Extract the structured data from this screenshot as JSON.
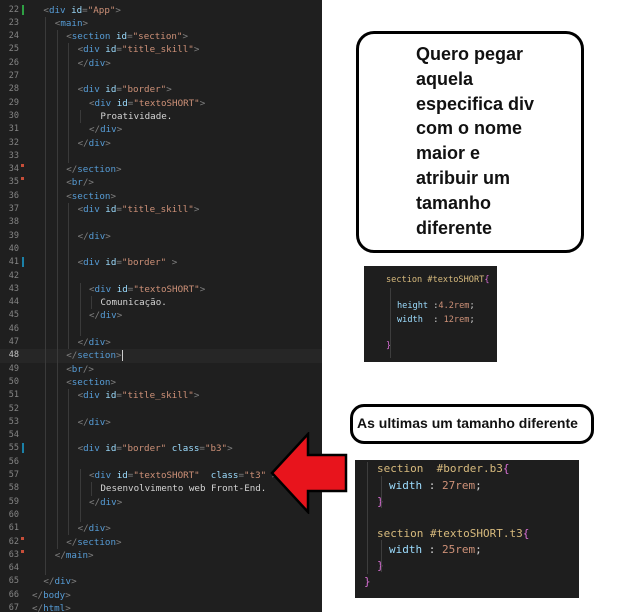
{
  "editor": {
    "lines": [
      {
        "n": "22",
        "indent": 1,
        "parts": [
          [
            "t",
            "<"
          ],
          [
            "tn",
            "div"
          ],
          [
            "sp",
            " "
          ],
          [
            "an",
            "id"
          ],
          [
            "t",
            "="
          ],
          [
            "av",
            "\"App\""
          ],
          [
            "t",
            ">"
          ]
        ]
      },
      {
        "n": "23",
        "indent": 2,
        "parts": [
          [
            "t",
            "<"
          ],
          [
            "tn",
            "main"
          ],
          [
            "t",
            ">"
          ]
        ]
      },
      {
        "n": "24",
        "indent": 3,
        "parts": [
          [
            "t",
            "<"
          ],
          [
            "tn",
            "section"
          ],
          [
            "sp",
            " "
          ],
          [
            "an",
            "id"
          ],
          [
            "t",
            "="
          ],
          [
            "av",
            "\"section\""
          ],
          [
            "t",
            ">"
          ]
        ]
      },
      {
        "n": "25",
        "indent": 4,
        "parts": [
          [
            "t",
            "<"
          ],
          [
            "tn",
            "div"
          ],
          [
            "sp",
            " "
          ],
          [
            "an",
            "id"
          ],
          [
            "t",
            "="
          ],
          [
            "av",
            "\"title_skill\""
          ],
          [
            "t",
            ">"
          ]
        ]
      },
      {
        "n": "26",
        "indent": 4,
        "parts": [
          [
            "t",
            "</"
          ],
          [
            "tn",
            "div"
          ],
          [
            "t",
            ">"
          ]
        ]
      },
      {
        "n": "27",
        "indent": 0,
        "parts": []
      },
      {
        "n": "28",
        "indent": 4,
        "parts": [
          [
            "t",
            "<"
          ],
          [
            "tn",
            "div"
          ],
          [
            "sp",
            " "
          ],
          [
            "an",
            "id"
          ],
          [
            "t",
            "="
          ],
          [
            "av",
            "\"border\""
          ],
          [
            "t",
            ">"
          ]
        ]
      },
      {
        "n": "29",
        "indent": 5,
        "parts": [
          [
            "t",
            "<"
          ],
          [
            "tn",
            "div"
          ],
          [
            "sp",
            " "
          ],
          [
            "an",
            "id"
          ],
          [
            "t",
            "="
          ],
          [
            "av",
            "\"textoSHORT\""
          ],
          [
            "t",
            ">"
          ]
        ]
      },
      {
        "n": "30",
        "indent": 6,
        "parts": [
          [
            "tx",
            "Proatividade."
          ]
        ]
      },
      {
        "n": "31",
        "indent": 5,
        "parts": [
          [
            "t",
            "</"
          ],
          [
            "tn",
            "div"
          ],
          [
            "t",
            ">"
          ]
        ]
      },
      {
        "n": "32",
        "indent": 4,
        "parts": [
          [
            "t",
            "</"
          ],
          [
            "tn",
            "div"
          ],
          [
            "t",
            ">"
          ]
        ]
      },
      {
        "n": "33",
        "indent": 0,
        "parts": []
      },
      {
        "n": "34",
        "indent": 3,
        "parts": [
          [
            "t",
            "</"
          ],
          [
            "tn",
            "section"
          ],
          [
            "t",
            ">"
          ]
        ]
      },
      {
        "n": "35",
        "indent": 3,
        "parts": [
          [
            "t",
            "<"
          ],
          [
            "tn",
            "br"
          ],
          [
            "t",
            "/>"
          ]
        ]
      },
      {
        "n": "36",
        "indent": 3,
        "parts": [
          [
            "t",
            "<"
          ],
          [
            "tn",
            "section"
          ],
          [
            "t",
            ">"
          ]
        ]
      },
      {
        "n": "37",
        "indent": 4,
        "parts": [
          [
            "t",
            "<"
          ],
          [
            "tn",
            "div"
          ],
          [
            "sp",
            " "
          ],
          [
            "an",
            "id"
          ],
          [
            "t",
            "="
          ],
          [
            "av",
            "\"title_skill\""
          ],
          [
            "t",
            ">"
          ]
        ]
      },
      {
        "n": "38",
        "indent": 0,
        "parts": []
      },
      {
        "n": "39",
        "indent": 4,
        "parts": [
          [
            "t",
            "</"
          ],
          [
            "tn",
            "div"
          ],
          [
            "t",
            ">"
          ]
        ]
      },
      {
        "n": "40",
        "indent": 0,
        "parts": []
      },
      {
        "n": "41",
        "indent": 4,
        "parts": [
          [
            "t",
            "<"
          ],
          [
            "tn",
            "div"
          ],
          [
            "sp",
            " "
          ],
          [
            "an",
            "id"
          ],
          [
            "t",
            "="
          ],
          [
            "av",
            "\"border\""
          ],
          [
            "sp",
            " "
          ],
          [
            "t",
            ">"
          ]
        ]
      },
      {
        "n": "42",
        "indent": 0,
        "parts": []
      },
      {
        "n": "43",
        "indent": 5,
        "parts": [
          [
            "t",
            "<"
          ],
          [
            "tn",
            "div"
          ],
          [
            "sp",
            " "
          ],
          [
            "an",
            "id"
          ],
          [
            "t",
            "="
          ],
          [
            "av",
            "\"textoSHORT\""
          ],
          [
            "t",
            ">"
          ]
        ]
      },
      {
        "n": "44",
        "indent": 6,
        "parts": [
          [
            "tx",
            "Comunicação."
          ]
        ]
      },
      {
        "n": "45",
        "indent": 5,
        "parts": [
          [
            "t",
            "</"
          ],
          [
            "tn",
            "div"
          ],
          [
            "t",
            ">"
          ]
        ]
      },
      {
        "n": "46",
        "indent": 0,
        "parts": []
      },
      {
        "n": "47",
        "indent": 4,
        "parts": [
          [
            "t",
            "</"
          ],
          [
            "tn",
            "div"
          ],
          [
            "t",
            ">"
          ]
        ]
      },
      {
        "n": "48",
        "indent": 3,
        "parts": [
          [
            "t",
            "</"
          ],
          [
            "tn",
            "section"
          ],
          [
            "t",
            ">"
          ]
        ]
      },
      {
        "n": "49",
        "indent": 3,
        "parts": [
          [
            "t",
            "<"
          ],
          [
            "tn",
            "br"
          ],
          [
            "t",
            "/>"
          ]
        ]
      },
      {
        "n": "50",
        "indent": 3,
        "parts": [
          [
            "t",
            "<"
          ],
          [
            "tn",
            "section"
          ],
          [
            "t",
            ">"
          ]
        ]
      },
      {
        "n": "51",
        "indent": 4,
        "parts": [
          [
            "t",
            "<"
          ],
          [
            "tn",
            "div"
          ],
          [
            "sp",
            " "
          ],
          [
            "an",
            "id"
          ],
          [
            "t",
            "="
          ],
          [
            "av",
            "\"title_skill\""
          ],
          [
            "t",
            ">"
          ]
        ]
      },
      {
        "n": "52",
        "indent": 0,
        "parts": []
      },
      {
        "n": "53",
        "indent": 4,
        "parts": [
          [
            "t",
            "</"
          ],
          [
            "tn",
            "div"
          ],
          [
            "t",
            ">"
          ]
        ]
      },
      {
        "n": "54",
        "indent": 0,
        "parts": []
      },
      {
        "n": "55",
        "indent": 4,
        "parts": [
          [
            "t",
            "<"
          ],
          [
            "tn",
            "div"
          ],
          [
            "sp",
            " "
          ],
          [
            "an",
            "id"
          ],
          [
            "t",
            "="
          ],
          [
            "av",
            "\"border\""
          ],
          [
            "sp",
            " "
          ],
          [
            "an",
            "class"
          ],
          [
            "t",
            "="
          ],
          [
            "av",
            "\"b3\""
          ],
          [
            "t",
            ">"
          ]
        ]
      },
      {
        "n": "56",
        "indent": 0,
        "parts": []
      },
      {
        "n": "57",
        "indent": 5,
        "parts": [
          [
            "t",
            "<"
          ],
          [
            "tn",
            "div"
          ],
          [
            "sp",
            " "
          ],
          [
            "an",
            "id"
          ],
          [
            "t",
            "="
          ],
          [
            "av",
            "\"textoSHORT\""
          ],
          [
            "sp",
            "  "
          ],
          [
            "an",
            "class"
          ],
          [
            "t",
            "="
          ],
          [
            "av",
            "\"t3\""
          ],
          [
            "sp",
            " "
          ],
          [
            "t",
            ">"
          ]
        ]
      },
      {
        "n": "58",
        "indent": 6,
        "parts": [
          [
            "tx",
            "Desenvolvimento web Front-End."
          ]
        ]
      },
      {
        "n": "59",
        "indent": 5,
        "parts": [
          [
            "t",
            "</"
          ],
          [
            "tn",
            "div"
          ],
          [
            "t",
            ">"
          ]
        ]
      },
      {
        "n": "60",
        "indent": 0,
        "parts": []
      },
      {
        "n": "61",
        "indent": 4,
        "parts": [
          [
            "t",
            "</"
          ],
          [
            "tn",
            "div"
          ],
          [
            "t",
            ">"
          ]
        ]
      },
      {
        "n": "62",
        "indent": 3,
        "parts": [
          [
            "t",
            "</"
          ],
          [
            "tn",
            "section"
          ],
          [
            "t",
            ">"
          ]
        ]
      },
      {
        "n": "63",
        "indent": 2,
        "parts": [
          [
            "t",
            "</"
          ],
          [
            "tn",
            "main"
          ],
          [
            "t",
            ">"
          ]
        ]
      },
      {
        "n": "64",
        "indent": 0,
        "parts": []
      },
      {
        "n": "65",
        "indent": 1,
        "parts": [
          [
            "t",
            "</"
          ],
          [
            "tn",
            "div"
          ],
          [
            "t",
            ">"
          ]
        ]
      },
      {
        "n": "66",
        "indent": 0,
        "parts": [
          [
            "t",
            "</"
          ],
          [
            "tn",
            "body"
          ],
          [
            "t",
            ">"
          ]
        ]
      },
      {
        "n": "67",
        "indent": 0,
        "parts": [
          [
            "t",
            "</"
          ],
          [
            "tn",
            "html"
          ],
          [
            "t",
            ">"
          ]
        ]
      }
    ]
  },
  "note": {
    "lines": [
      "Quero pegar",
      "aquela",
      "especifica div",
      "com o nome",
      "maior e",
      "atribuir um",
      "tamanho",
      "diferente"
    ]
  },
  "snippet1": {
    "selector": "section #textoSHORT",
    "props": [
      {
        "name": "height",
        "sep": " :",
        "value": "4.2rem"
      },
      {
        "name": "width",
        "sep": "  :",
        "value": " 12rem"
      }
    ]
  },
  "caption": {
    "text": "As ultimas um tamanho diferente"
  },
  "snippet2": {
    "rules": [
      {
        "selector": "section  #border.b3",
        "prop": "width",
        "sep": " : ",
        "value": "27rem"
      },
      {
        "selector": "section #textoSHORT.t3",
        "prop": "width",
        "sep": " : ",
        "value": "25rem"
      }
    ]
  },
  "colors": {
    "editor_bg": "#1f1f1f",
    "tag": "#569cd6",
    "attr_name": "#9cdcfe",
    "attr_value": "#ce9178",
    "css_selector": "#d7ba7d",
    "arrow": "#e8141c"
  }
}
